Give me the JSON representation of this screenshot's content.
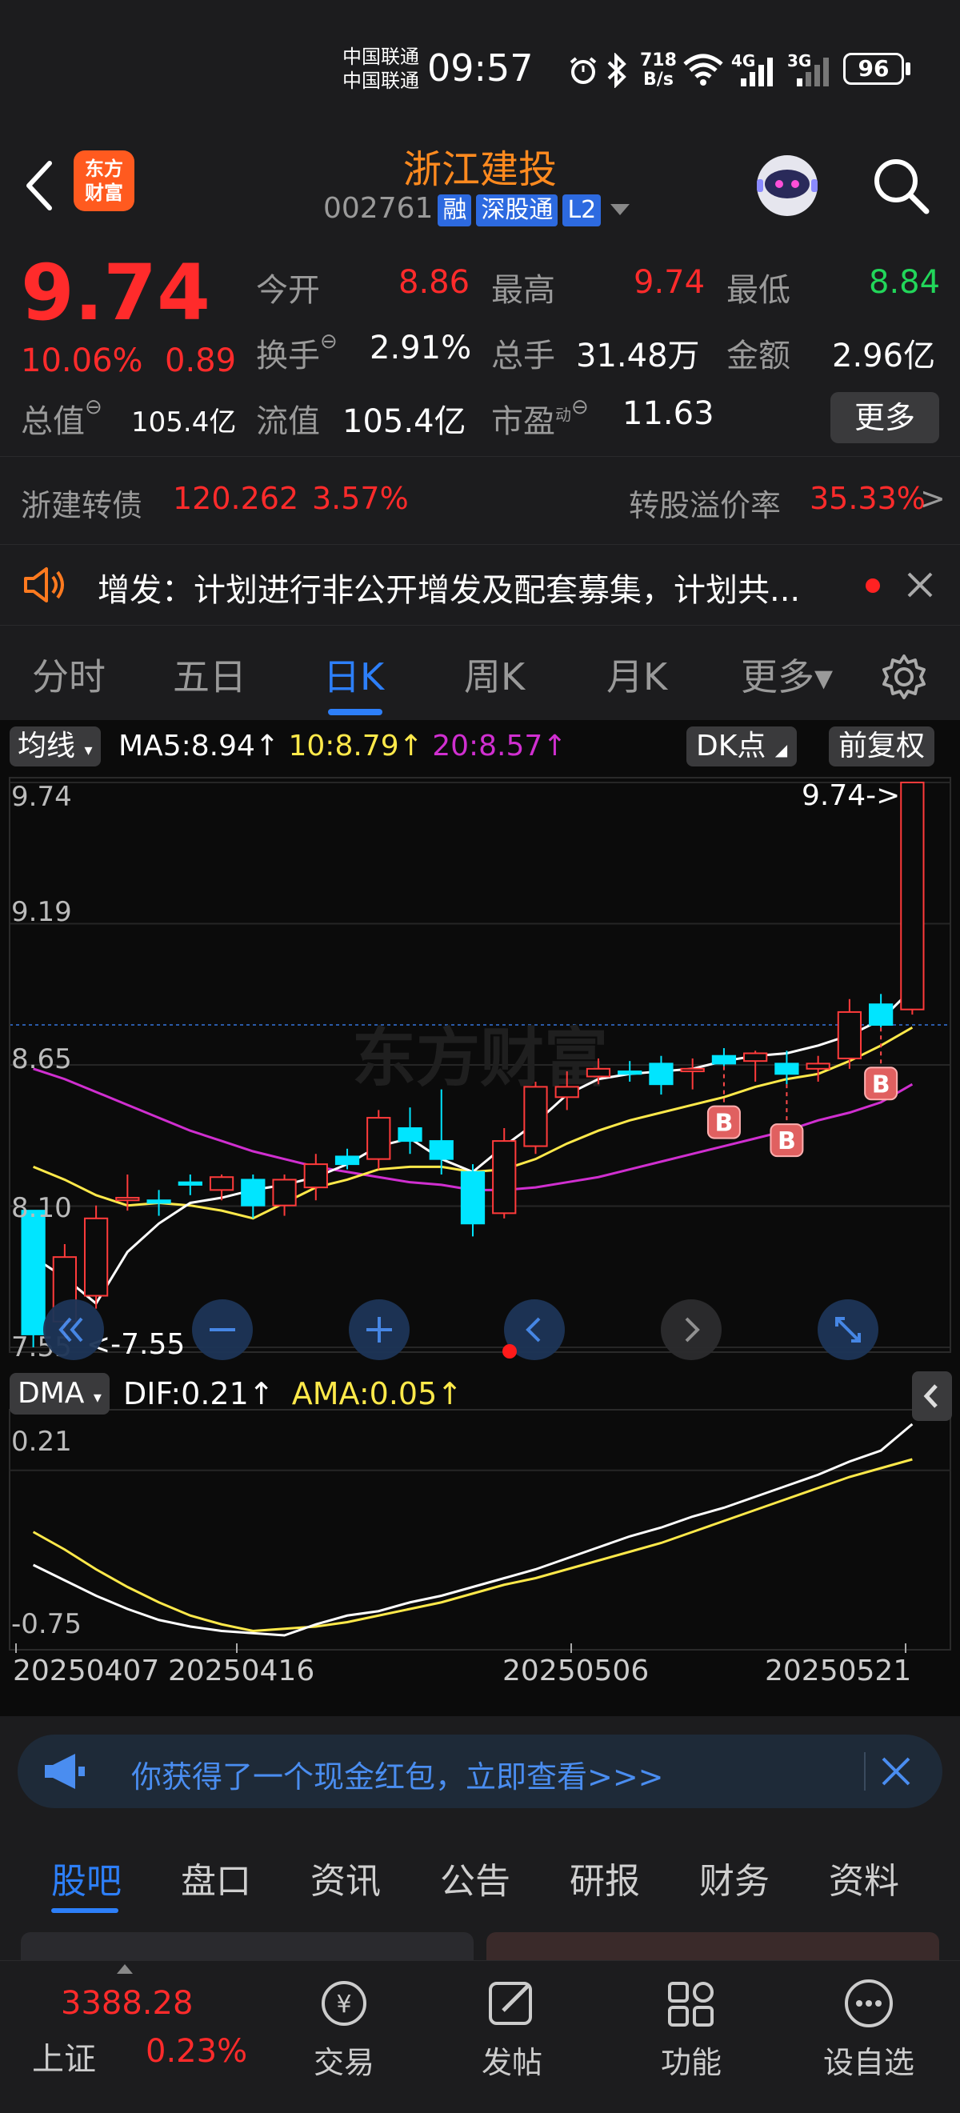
{
  "status": {
    "carrier1": "中国联通",
    "carrier2": "中国联通",
    "time": "09:57",
    "speed_top": "718",
    "speed_unit": "B/s",
    "net1": "4G",
    "net2": "3G",
    "battery": "96"
  },
  "header": {
    "logo_text1": "东方",
    "logo_text2": "财富",
    "stock_name": "浙江建投",
    "stock_code": "002761",
    "tags": [
      "融",
      "深股通",
      "L2"
    ]
  },
  "quote": {
    "price": "9.74",
    "change_pct": "10.06%",
    "change_amt": "0.89",
    "open_label": "今开",
    "open": "8.86",
    "high_label": "最高",
    "high": "9.74",
    "low_label": "最低",
    "low": "8.84",
    "turnover_label": "换手",
    "turnover": "2.91%",
    "volume_label": "总手",
    "volume": "31.48万",
    "amount_label": "金额",
    "amount": "2.96亿",
    "mktcap_label": "总值",
    "mktcap": "105.4亿",
    "float_label": "流值",
    "float": "105.4亿",
    "pe_label": "市盈",
    "pe_sup": "动",
    "pe": "11.63",
    "more_button": "更多"
  },
  "convertible": {
    "name": "浙建转债",
    "price": "120.262",
    "pct": "3.57%",
    "premium_label": "转股溢价率",
    "premium": "35.33%",
    "arrow": ">"
  },
  "notice": {
    "text": "增发：计划进行非公开增发及配套募集，计划共..."
  },
  "period_tabs": [
    "分时",
    "五日",
    "日K",
    "周K",
    "月K",
    "更多▾"
  ],
  "active_period": 2,
  "chart": {
    "indicator_btn": "均线",
    "ma5": "MA5:8.94↑",
    "ma10": "10:8.79↑",
    "ma20": "20:8.57↑",
    "dk_btn": "DK点",
    "adjust_btn": "前复权",
    "y_labels": [
      "9.74",
      "9.19",
      "8.65",
      "8.10",
      "7.55"
    ],
    "last_price_tag": "9.74->",
    "low_tag": "<-7.55",
    "watermark": "东方财富",
    "dma_btn": "DMA",
    "dif": "DIF:0.21↑",
    "ama": "AMA:0.05↑",
    "dma_y_labels": [
      "0.21",
      "-0.75"
    ],
    "dates": [
      "20250407",
      "20250416",
      "20250506",
      "20250521"
    ],
    "colors": {
      "up": "#ff3b3b",
      "down": "#00e5ff",
      "ma5": "#ffffff",
      "ma10": "#ffe94a",
      "ma20": "#d02fd0"
    }
  },
  "chart_data": {
    "type": "candlestick",
    "ylim": [
      7.55,
      9.74
    ],
    "candles": [
      {
        "o": 8.08,
        "h": 8.08,
        "l": 7.55,
        "c": 7.6
      },
      {
        "o": 7.65,
        "h": 7.95,
        "l": 7.58,
        "c": 7.9
      },
      {
        "o": 7.75,
        "h": 8.1,
        "l": 7.7,
        "c": 8.05
      },
      {
        "o": 8.12,
        "h": 8.22,
        "l": 8.08,
        "c": 8.13
      },
      {
        "o": 8.12,
        "h": 8.16,
        "l": 8.06,
        "c": 8.11
      },
      {
        "o": 8.19,
        "h": 8.22,
        "l": 8.14,
        "c": 8.18
      },
      {
        "o": 8.16,
        "h": 8.22,
        "l": 8.12,
        "c": 8.21
      },
      {
        "o": 8.2,
        "h": 8.22,
        "l": 8.05,
        "c": 8.1
      },
      {
        "o": 8.1,
        "h": 8.22,
        "l": 8.06,
        "c": 8.2
      },
      {
        "o": 8.17,
        "h": 8.3,
        "l": 8.12,
        "c": 8.26
      },
      {
        "o": 8.29,
        "h": 8.32,
        "l": 8.24,
        "c": 8.26
      },
      {
        "o": 8.28,
        "h": 8.47,
        "l": 8.24,
        "c": 8.44
      },
      {
        "o": 8.4,
        "h": 8.48,
        "l": 8.3,
        "c": 8.35
      },
      {
        "o": 8.35,
        "h": 8.55,
        "l": 8.22,
        "c": 8.28
      },
      {
        "o": 8.23,
        "h": 8.26,
        "l": 7.98,
        "c": 8.03
      },
      {
        "o": 8.07,
        "h": 8.4,
        "l": 8.05,
        "c": 8.35
      },
      {
        "o": 8.33,
        "h": 8.58,
        "l": 8.3,
        "c": 8.56
      },
      {
        "o": 8.52,
        "h": 8.62,
        "l": 8.47,
        "c": 8.56
      },
      {
        "o": 8.6,
        "h": 8.67,
        "l": 8.57,
        "c": 8.63
      },
      {
        "o": 8.62,
        "h": 8.66,
        "l": 8.58,
        "c": 8.61
      },
      {
        "o": 8.65,
        "h": 8.68,
        "l": 8.53,
        "c": 8.57
      },
      {
        "o": 8.62,
        "h": 8.67,
        "l": 8.55,
        "c": 8.63
      },
      {
        "o": 8.68,
        "h": 8.71,
        "l": 8.64,
        "c": 8.65
      },
      {
        "o": 8.66,
        "h": 8.7,
        "l": 8.58,
        "c": 8.69
      },
      {
        "o": 8.65,
        "h": 8.7,
        "l": 8.57,
        "c": 8.61
      },
      {
        "o": 8.63,
        "h": 8.68,
        "l": 8.58,
        "c": 8.65
      },
      {
        "o": 8.67,
        "h": 8.9,
        "l": 8.63,
        "c": 8.85
      },
      {
        "o": 8.88,
        "h": 8.92,
        "l": 8.79,
        "c": 8.8
      },
      {
        "o": 8.86,
        "h": 9.74,
        "l": 8.84,
        "c": 9.74
      }
    ],
    "ma5": [
      7.9,
      7.82,
      7.72,
      7.92,
      8.03,
      8.11,
      8.13,
      8.16,
      8.18,
      8.21,
      8.26,
      8.33,
      8.36,
      8.28,
      8.23,
      8.33,
      8.42,
      8.53,
      8.59,
      8.61,
      8.62,
      8.63,
      8.66,
      8.68,
      8.69,
      8.72,
      8.76,
      8.82,
      8.94
    ],
    "ma10": [
      8.25,
      8.2,
      8.14,
      8.1,
      8.11,
      8.1,
      8.08,
      8.05,
      8.11,
      8.17,
      8.2,
      8.24,
      8.25,
      8.25,
      8.23,
      8.24,
      8.28,
      8.34,
      8.39,
      8.43,
      8.46,
      8.49,
      8.52,
      8.56,
      8.59,
      8.61,
      8.66,
      8.72,
      8.79
    ],
    "ma20": [
      8.63,
      8.59,
      8.54,
      8.49,
      8.44,
      8.39,
      8.35,
      8.31,
      8.28,
      8.25,
      8.23,
      8.21,
      8.19,
      8.18,
      8.16,
      8.16,
      8.17,
      8.19,
      8.21,
      8.24,
      8.27,
      8.3,
      8.33,
      8.36,
      8.39,
      8.43,
      8.46,
      8.5,
      8.57
    ],
    "dif": [
      -0.43,
      -0.5,
      -0.57,
      -0.63,
      -0.68,
      -0.71,
      -0.73,
      -0.74,
      -0.75,
      -0.7,
      -0.66,
      -0.64,
      -0.6,
      -0.57,
      -0.53,
      -0.49,
      -0.45,
      -0.4,
      -0.35,
      -0.3,
      -0.26,
      -0.21,
      -0.17,
      -0.12,
      -0.07,
      -0.02,
      0.04,
      0.09,
      0.21
    ],
    "ama": [
      -0.28,
      -0.36,
      -0.45,
      -0.53,
      -0.6,
      -0.66,
      -0.7,
      -0.73,
      -0.72,
      -0.71,
      -0.69,
      -0.66,
      -0.63,
      -0.6,
      -0.56,
      -0.52,
      -0.49,
      -0.45,
      -0.41,
      -0.37,
      -0.33,
      -0.28,
      -0.23,
      -0.18,
      -0.13,
      -0.08,
      -0.03,
      0.01,
      0.05
    ],
    "dma_ylim": [
      -0.75,
      0.21
    ],
    "signals": [
      {
        "index": 22,
        "label": "B"
      },
      {
        "index": 24,
        "label": "B"
      },
      {
        "index": 27,
        "label": "B"
      }
    ]
  },
  "promo": {
    "text": "你获得了一个现金红包，立即查看>>>"
  },
  "bottom_tabs": [
    "股吧",
    "盘口",
    "资讯",
    "公告",
    "研报",
    "财务",
    "资料"
  ],
  "footer": {
    "index_value": "3388.28",
    "index_name": "上证",
    "index_pct": "0.23%",
    "items": [
      "交易",
      "发帖",
      "功能",
      "设自选"
    ]
  }
}
